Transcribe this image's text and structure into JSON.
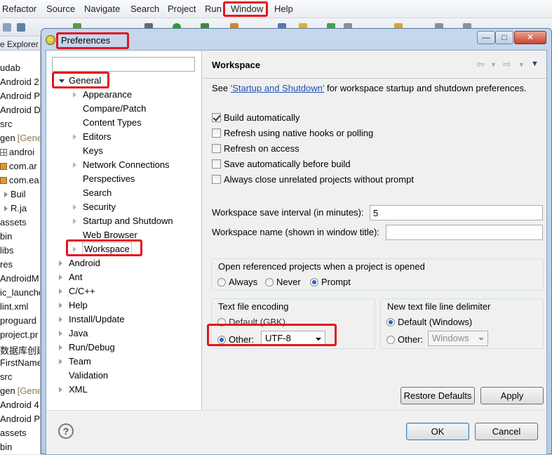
{
  "menubar": {
    "items": [
      {
        "label": "Refactor"
      },
      {
        "label": "Source"
      },
      {
        "label": "Navigate"
      },
      {
        "label": "Search"
      },
      {
        "label": "Project"
      },
      {
        "label": "Run"
      },
      {
        "label": "Window"
      },
      {
        "label": "Help"
      }
    ]
  },
  "explorer": {
    "title": "e Explorer",
    "rows": [
      {
        "label": "udab"
      },
      {
        "label": "Android 2"
      },
      {
        "label": "Android P"
      },
      {
        "label": "Android D"
      },
      {
        "label": "src"
      },
      {
        "label": "gen",
        "suffix": "[Gene"
      },
      {
        "label": "androi"
      },
      {
        "label": "com.ar"
      },
      {
        "label": "com.ea"
      },
      {
        "label": "Buil"
      },
      {
        "label": "R.ja"
      },
      {
        "label": "assets"
      },
      {
        "label": "bin"
      },
      {
        "label": "libs"
      },
      {
        "label": "res"
      },
      {
        "label": "AndroidM"
      },
      {
        "label": "ic_launche"
      },
      {
        "label": "lint.xml"
      },
      {
        "label": "proguard"
      },
      {
        "label": "project.pr"
      },
      {
        "label": "数据库创建"
      },
      {
        "label": "FirstName"
      },
      {
        "label": "src"
      },
      {
        "label": "gen",
        "suffix": "[Gene"
      },
      {
        "label": "Android 4"
      },
      {
        "label": "Android P"
      },
      {
        "label": "assets"
      },
      {
        "label": "bin"
      }
    ]
  },
  "dialog": {
    "title": "Preferences",
    "filter_placeholder": "",
    "tree": [
      {
        "label": "General",
        "level": 0,
        "state": "open"
      },
      {
        "label": "Appearance",
        "level": 1,
        "state": "closed"
      },
      {
        "label": "Compare/Patch",
        "level": 1,
        "state": "leaf"
      },
      {
        "label": "Content Types",
        "level": 1,
        "state": "leaf"
      },
      {
        "label": "Editors",
        "level": 1,
        "state": "closed"
      },
      {
        "label": "Keys",
        "level": 1,
        "state": "leaf"
      },
      {
        "label": "Network Connections",
        "level": 1,
        "state": "closed"
      },
      {
        "label": "Perspectives",
        "level": 1,
        "state": "leaf"
      },
      {
        "label": "Search",
        "level": 1,
        "state": "leaf"
      },
      {
        "label": "Security",
        "level": 1,
        "state": "closed"
      },
      {
        "label": "Startup and Shutdown",
        "level": 1,
        "state": "closed"
      },
      {
        "label": "Web Browser",
        "level": 1,
        "state": "leaf"
      },
      {
        "label": "Workspace",
        "level": 1,
        "state": "closed",
        "selected": true
      },
      {
        "label": "Android",
        "level": 0,
        "state": "closed"
      },
      {
        "label": "Ant",
        "level": 0,
        "state": "closed"
      },
      {
        "label": "C/C++",
        "level": 0,
        "state": "closed"
      },
      {
        "label": "Help",
        "level": 0,
        "state": "closed"
      },
      {
        "label": "Install/Update",
        "level": 0,
        "state": "closed"
      },
      {
        "label": "Java",
        "level": 0,
        "state": "closed"
      },
      {
        "label": "Run/Debug",
        "level": 0,
        "state": "closed"
      },
      {
        "label": "Team",
        "level": 0,
        "state": "closed"
      },
      {
        "label": "Validation",
        "level": 0,
        "state": "leaf"
      },
      {
        "label": "XML",
        "level": 0,
        "state": "closed"
      }
    ],
    "page": {
      "title": "Workspace",
      "see_prefix": "See ",
      "see_link": "'Startup and Shutdown'",
      "see_suffix": " for workspace startup and shutdown preferences.",
      "checkboxes": [
        {
          "label": "Build automatically",
          "checked": true
        },
        {
          "label": "Refresh using native hooks or polling",
          "checked": false
        },
        {
          "label": "Refresh on access",
          "checked": false
        },
        {
          "label": "Save automatically before build",
          "checked": false
        },
        {
          "label": "Always close unrelated projects without prompt",
          "checked": false
        }
      ],
      "save_interval_label": "Workspace save interval (in minutes):",
      "save_interval_value": "5",
      "ws_name_label": "Workspace name (shown in window title):",
      "ws_name_value": "",
      "open_ref_group": {
        "label": "Open referenced projects when a project is opened",
        "options": [
          {
            "label": "Always",
            "selected": false
          },
          {
            "label": "Never",
            "selected": false
          },
          {
            "label": "Prompt",
            "selected": true
          }
        ]
      },
      "encoding_group": {
        "label": "Text file encoding",
        "default_label": "Default (GBK)",
        "default_selected": false,
        "other_label": "Other:",
        "other_selected": true,
        "other_value": "UTF-8"
      },
      "delimiter_group": {
        "label": "New text file line delimiter",
        "default_label": "Default (Windows)",
        "default_selected": true,
        "other_label": "Other:",
        "other_selected": false,
        "other_value": "Windows"
      },
      "restore_defaults_label": "Restore Defaults",
      "apply_label": "Apply"
    },
    "ok_label": "OK",
    "cancel_label": "Cancel",
    "help_glyph": "?"
  },
  "colors": {
    "highlight": "#e5141b",
    "link": "#1f4fb0",
    "radio_selected": "#2b63c8"
  }
}
